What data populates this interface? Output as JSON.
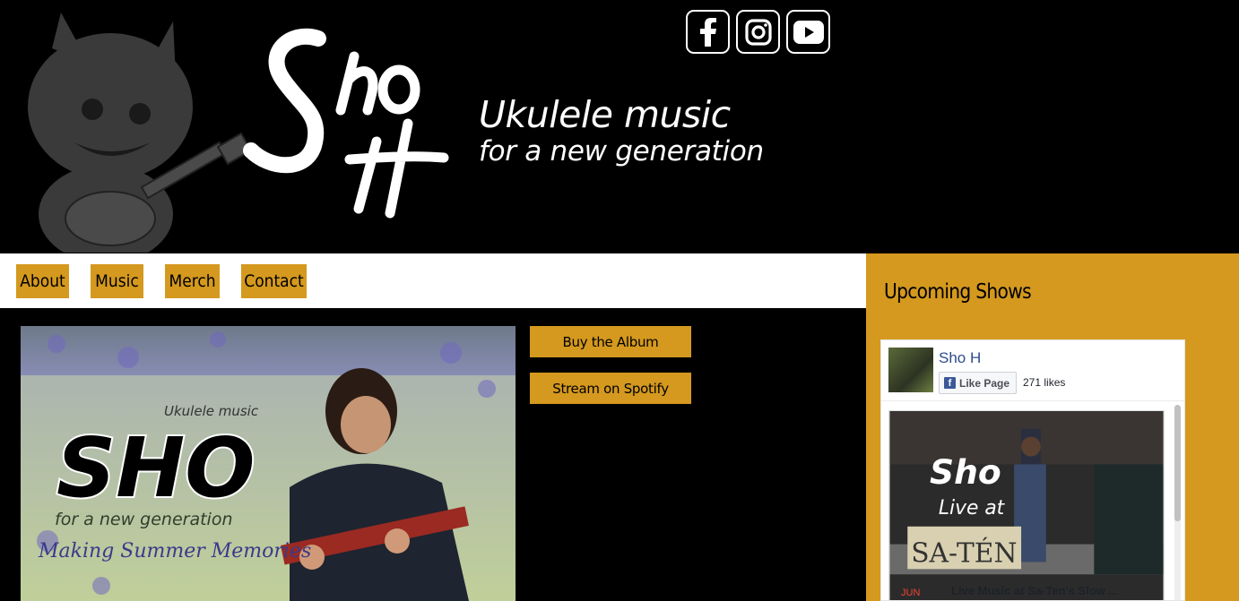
{
  "header": {
    "logo_text": "Sho H",
    "tagline_line1": "Ukulele music",
    "tagline_line2": "for a new generation",
    "social": [
      {
        "icon": "facebook-icon"
      },
      {
        "icon": "instagram-icon"
      },
      {
        "icon": "youtube-icon"
      }
    ]
  },
  "nav": {
    "items": [
      {
        "label": "About"
      },
      {
        "label": "Music"
      },
      {
        "label": "Merch"
      },
      {
        "label": "Contact"
      }
    ]
  },
  "main": {
    "album_image": {
      "subtitle_top": "Ukulele music",
      "title": "SHO",
      "subtitle_bottom": "for a new generation",
      "caption": "Making Summer Memories"
    },
    "buy_label": "Buy the Album",
    "spotify_label": "Stream on Spotify"
  },
  "sidebar": {
    "title": "Upcoming Shows",
    "fb_widget": {
      "page_name": "Sho H",
      "like_label": "Like Page",
      "likes": "271 likes",
      "post_image_line1": "Sho",
      "post_image_line2": "Live at",
      "post_image_venue": "SA-TÉN",
      "event_month": "JUN",
      "event_title": "Live Music at Sa-Ten's Slow ..."
    }
  },
  "colors": {
    "accent": "#d4991e",
    "header_bg": "#000000",
    "nav_bg": "#ffffff",
    "fb_blue": "#3b5998"
  }
}
